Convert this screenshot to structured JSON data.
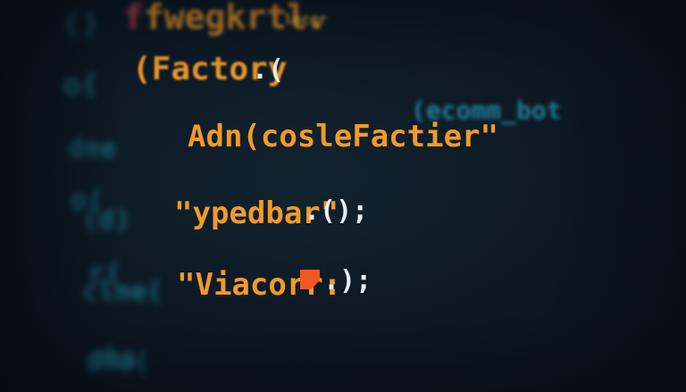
{
  "code_lines": [
    {
      "prefix": "",
      "main": "fwegkrtl.",
      "tail": "lecgr"
    },
    {
      "prefix": "",
      "main": "(Factory",
      "tail": ".("
    },
    {
      "prefix": "dne",
      "main": "Adn(cosleFactier\"",
      "tail": "(ecomm_bot"
    },
    {
      "prefix": "(d)",
      "main": "\"ypedbar\"",
      "tail": ".();"
    },
    {
      "prefix": "clne(",
      "main": "\"Viacorr:",
      "tail": ".);"
    },
    {
      "prefix": "dhe(",
      "main": "",
      "tail": ""
    }
  ],
  "colors": {
    "teal": "#1f7f96",
    "orange": "#f09a2a",
    "yellow": "#f5c23a",
    "cursor": "#ee5a1f",
    "background": "#0b1520"
  }
}
